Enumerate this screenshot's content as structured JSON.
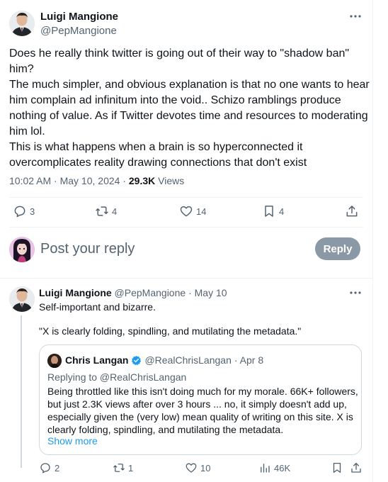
{
  "colors": {
    "accent": "#1d9bf0",
    "muted": "#536471",
    "verified": "#1d9bf0",
    "reply_button_bg": "#8b98a5"
  },
  "main_tweet": {
    "author_name": "Luigi Mangione",
    "author_handle": "@PepMangione",
    "more_icon": "more-horizontal-icon",
    "lines": [
      "Does he really think twitter is going out of their way to \"shadow ban\"",
      "him?",
      "The much simpler, and obvious explanation is that no one wants to hear",
      "him complain ad infinitum into the void.. Schizo ramblings produce",
      "nothing of value. As if Twitter devotes time and resources to moderating",
      "him lol.",
      "This is what happens when a brain is so hyperconnected it",
      "overcomplicates reality drawing connections that don't exist"
    ],
    "time": "10:02 AM · May 10, 2024 · ",
    "views_count": "29.3K",
    "views_label": " Views",
    "actions": {
      "replies": "3",
      "reposts": "4",
      "likes": "14",
      "bookmarks": "4"
    }
  },
  "composer": {
    "placeholder": "Post your reply",
    "button_label": "Reply"
  },
  "reply_tweet": {
    "author_name": "Luigi Mangione",
    "author_handle": "@PepMangione",
    "date": "· May 10",
    "lines": [
      "Self-important and bizarre.",
      "\"X is clearly folding, spindling, and mutilating the metadata.\""
    ],
    "quote": {
      "author_name": "Chris Langan",
      "author_handle": "@RealChrisLangan",
      "date": "· Apr 8",
      "replying_to": "Replying to @RealChrisLangan",
      "lines": [
        "Being throttled like this isn't doing much for my morale. 66K+ followers,",
        "but just 2.3K views after over 3 hours ... no, it simply doesn't add up,",
        "especially given the (very low) mean quality of writing on this site. X is",
        "clearly folding, spindling, and mutilating the metadata."
      ],
      "show_more": "Show more"
    },
    "actions": {
      "replies": "2",
      "reposts": "1",
      "likes": "10",
      "views": "46K"
    }
  }
}
